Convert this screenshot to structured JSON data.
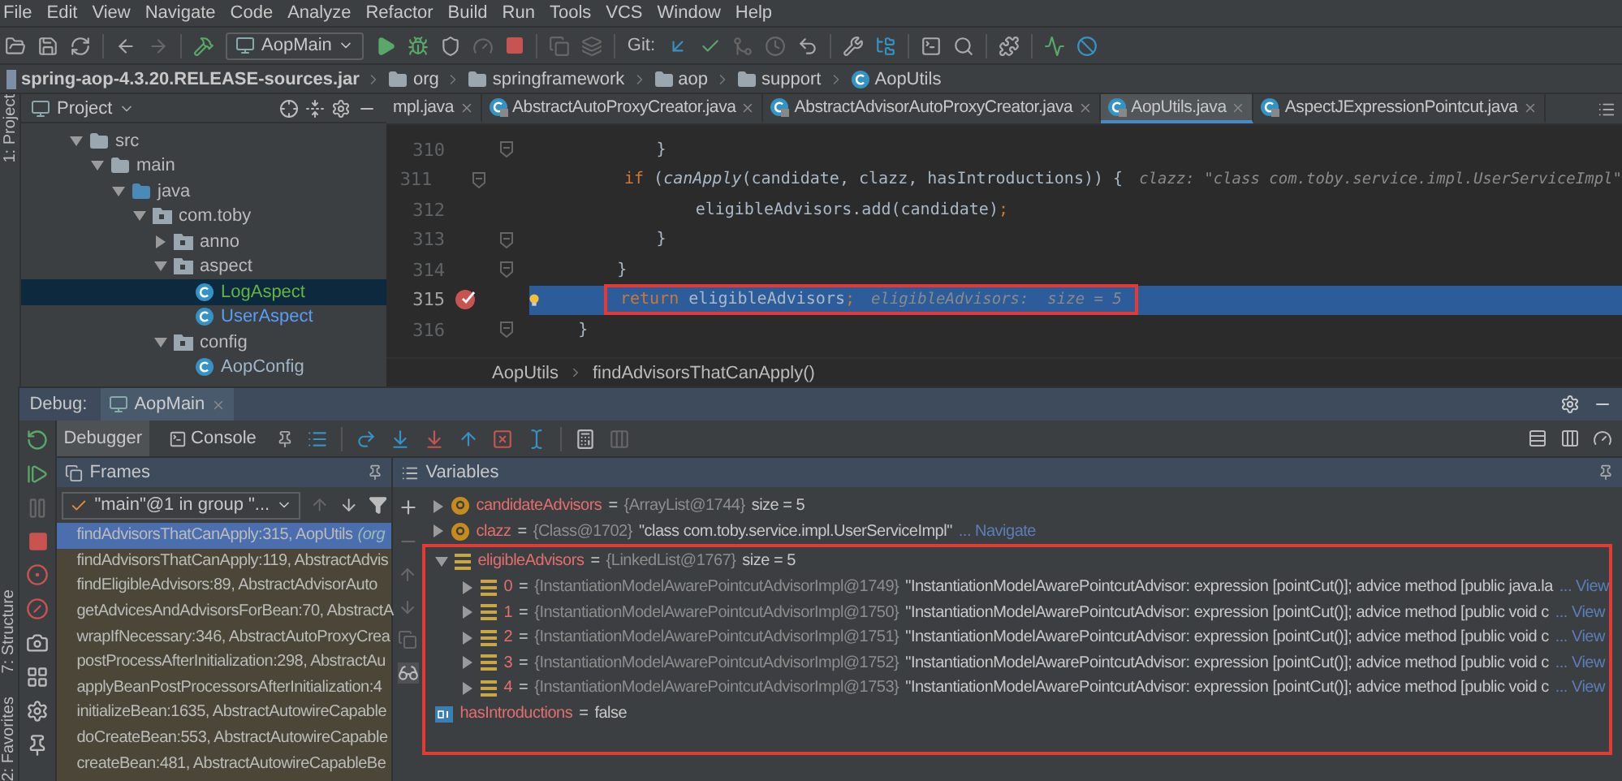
{
  "menu": [
    "File",
    "Edit",
    "View",
    "Navigate",
    "Code",
    "Analyze",
    "Refactor",
    "Build",
    "Run",
    "Tools",
    "VCS",
    "Window",
    "Help"
  ],
  "toolbar": {
    "run_config": "AopMain",
    "git_label": "Git:"
  },
  "nav_bar": [
    {
      "label": "spring-aop-4.3.20.RELEASE-sources.jar",
      "kind": "jar"
    },
    {
      "label": "org",
      "kind": "folder"
    },
    {
      "label": "springframework",
      "kind": "folder"
    },
    {
      "label": "aop",
      "kind": "folder"
    },
    {
      "label": "support",
      "kind": "folder"
    },
    {
      "label": "AopUtils",
      "kind": "class"
    }
  ],
  "side_strip": {
    "top": "1: Project",
    "bottom": [
      "7: Structure",
      "2: Favorites"
    ]
  },
  "project": {
    "title": "Project",
    "tree": [
      {
        "label": "src",
        "kind": "folder",
        "expanded": true,
        "selected": false,
        "color": "#bbbbbb",
        "children": [
          {
            "label": "main",
            "kind": "folder",
            "expanded": true,
            "selected": false,
            "color": "#bbbbbb",
            "children": [
              {
                "label": "java",
                "kind": "source",
                "expanded": true,
                "selected": false,
                "color": "#bbbbbb",
                "children": [
                  {
                    "label": "com.toby",
                    "kind": "package",
                    "expanded": true,
                    "selected": false,
                    "color": "#bbbbbb",
                    "children": [
                      {
                        "label": "anno",
                        "kind": "package",
                        "expanded": false,
                        "selected": false,
                        "color": "#bbbbbb"
                      },
                      {
                        "label": "aspect",
                        "kind": "package",
                        "expanded": true,
                        "selected": false,
                        "color": "#bbbbbb",
                        "children": [
                          {
                            "label": "LogAspect",
                            "kind": "class",
                            "selected": true,
                            "color": "#62b543"
                          },
                          {
                            "label": "UserAspect",
                            "kind": "class",
                            "selected": false,
                            "color": "#589df6"
                          }
                        ]
                      },
                      {
                        "label": "config",
                        "kind": "package",
                        "expanded": true,
                        "selected": false,
                        "color": "#bbbbbb",
                        "children": [
                          {
                            "label": "AopConfig",
                            "kind": "class",
                            "selected": false,
                            "color": "#a0b5c8"
                          }
                        ]
                      }
                    ]
                  }
                ]
              }
            ]
          }
        ]
      }
    ]
  },
  "editor": {
    "tabs": [
      {
        "label": "mpl.java",
        "selected": false
      },
      {
        "label": "AbstractAutoProxyCreator.java",
        "selected": false
      },
      {
        "label": "AbstractAdvisorAutoProxyCreator.java",
        "selected": false
      },
      {
        "label": "AopUtils.java",
        "selected": true
      },
      {
        "label": "AspectJExpressionPointcut.java",
        "selected": false
      }
    ],
    "lines": [
      {
        "number": "310",
        "fold": true,
        "current": false,
        "breakpoint": false,
        "intention": false,
        "boxed": false,
        "code": [
          {
            "text": "            }",
            "kind": "plain"
          }
        ]
      },
      {
        "number": "311",
        "fold": true,
        "current": false,
        "breakpoint": false,
        "intention": false,
        "boxed": false,
        "code": [
          {
            "text": "            if ",
            "kind": "keyword"
          },
          {
            "text": "(",
            "kind": "plain"
          },
          {
            "text": "canApply",
            "kind": "static"
          },
          {
            "text": "(candidate, clazz, hasIntroductions)) {",
            "kind": "plain"
          }
        ],
        "hint": "clazz: \"class com.toby.service.impl.UserServiceImpl\""
      },
      {
        "number": "312",
        "fold": false,
        "current": false,
        "breakpoint": false,
        "intention": false,
        "boxed": false,
        "code": [
          {
            "text": "                eligibleAdvisors.add(candidate)",
            "kind": "plain"
          },
          {
            "text": ";",
            "kind": "keyword"
          }
        ]
      },
      {
        "number": "313",
        "fold": true,
        "current": false,
        "breakpoint": false,
        "intention": false,
        "boxed": false,
        "code": [
          {
            "text": "            }",
            "kind": "plain"
          }
        ]
      },
      {
        "number": "314",
        "fold": true,
        "current": false,
        "breakpoint": false,
        "intention": false,
        "boxed": false,
        "code": [
          {
            "text": "        }",
            "kind": "plain"
          }
        ]
      },
      {
        "number": "315",
        "fold": false,
        "current": true,
        "breakpoint": true,
        "intention": true,
        "boxed": true,
        "code": [
          {
            "text": "return ",
            "kind": "keyword"
          },
          {
            "text": "eligibleAdvisors",
            "kind": "plain"
          },
          {
            "text": ";",
            "kind": "keyword"
          }
        ],
        "hint": "eligibleAdvisors:  size = 5"
      },
      {
        "number": "316",
        "fold": true,
        "current": false,
        "breakpoint": false,
        "intention": false,
        "boxed": false,
        "code": [
          {
            "text": "    }",
            "kind": "plain"
          }
        ]
      }
    ],
    "breadcrumbs": [
      "AopUtils",
      "findAdvisorsThatCanApply()"
    ]
  },
  "debug": {
    "title": "Debug:",
    "session": "AopMain",
    "tabs": [
      {
        "label": "Debugger",
        "selected": true
      },
      {
        "label": "Console",
        "selected": false
      }
    ],
    "frames": {
      "title": "Frames",
      "thread": "\"main\"@1 in group \"...",
      "items": [
        {
          "label": "findAdvisorsThatCanApply:315, AopUtils",
          "detail": "(org",
          "selected": true
        },
        {
          "label": "findAdvisorsThatCanApply:119, AbstractAdvis",
          "selected": false
        },
        {
          "label": "findEligibleAdvisors:89, AbstractAdvisorAuto",
          "selected": false
        },
        {
          "label": "getAdvicesAndAdvisorsForBean:70, AbstractA",
          "selected": false
        },
        {
          "label": "wrapIfNecessary:346, AbstractAutoProxyCrea",
          "selected": false
        },
        {
          "label": "postProcessAfterInitialization:298, AbstractAu",
          "selected": false
        },
        {
          "label": "applyBeanPostProcessorsAfterInitialization:4",
          "selected": false
        },
        {
          "label": "initializeBean:1635, AbstractAutowireCapable",
          "selected": false
        },
        {
          "label": "doCreateBean:553, AbstractAutowireCapable",
          "selected": false
        },
        {
          "label": "createBean:481, AbstractAutowireCapableBe",
          "selected": false
        }
      ]
    },
    "variables": {
      "title": "Variables",
      "items": [
        {
          "name": "candidateAdvisors",
          "separator": "=",
          "kind": "field",
          "expanded": false,
          "boxed": false,
          "type": "{ArrayList@1744}",
          "value": "size = 5"
        },
        {
          "name": "clazz",
          "separator": "=",
          "kind": "field",
          "expanded": false,
          "boxed": false,
          "type": "{Class@1702}",
          "value": "\"class com.toby.service.impl.UserServiceImpl\"",
          "link": "... Navigate"
        },
        {
          "name": "eligibleAdvisors",
          "separator": "=",
          "kind": "list",
          "expanded": true,
          "boxed": true,
          "type": "{LinkedList@1767}",
          "value": "size = 5",
          "children": [
            {
              "name": "0",
              "separator": "=",
              "kind": "list",
              "expanded": false,
              "type": "{InstantiationModelAwarePointcutAdvisorImpl@1749}",
              "value": "\"InstantiationModelAwarePointcutAdvisor: expression [pointCut()]; advice method [public java.la",
              "link": "... View"
            },
            {
              "name": "1",
              "separator": "=",
              "kind": "list",
              "expanded": false,
              "type": "{InstantiationModelAwarePointcutAdvisorImpl@1750}",
              "value": "\"InstantiationModelAwarePointcutAdvisor: expression [pointCut()]; advice method [public void c",
              "link": "... View"
            },
            {
              "name": "2",
              "separator": "=",
              "kind": "list",
              "expanded": false,
              "type": "{InstantiationModelAwarePointcutAdvisorImpl@1751}",
              "value": "\"InstantiationModelAwarePointcutAdvisor: expression [pointCut()]; advice method [public void c",
              "link": "... View"
            },
            {
              "name": "3",
              "separator": "=",
              "kind": "list",
              "expanded": false,
              "type": "{InstantiationModelAwarePointcutAdvisorImpl@1752}",
              "value": "\"InstantiationModelAwarePointcutAdvisor: expression [pointCut()]; advice method [public void c",
              "link": "... View"
            },
            {
              "name": "4",
              "separator": "=",
              "kind": "list",
              "expanded": false,
              "type": "{InstantiationModelAwarePointcutAdvisorImpl@1753}",
              "value": "\"InstantiationModelAwarePointcutAdvisor: expression [pointCut()]; advice method [public void c",
              "link": "... View"
            }
          ]
        },
        {
          "name": "hasIntroductions",
          "separator": "=",
          "kind": "primitive",
          "boxed": true,
          "value": "false"
        }
      ]
    }
  }
}
